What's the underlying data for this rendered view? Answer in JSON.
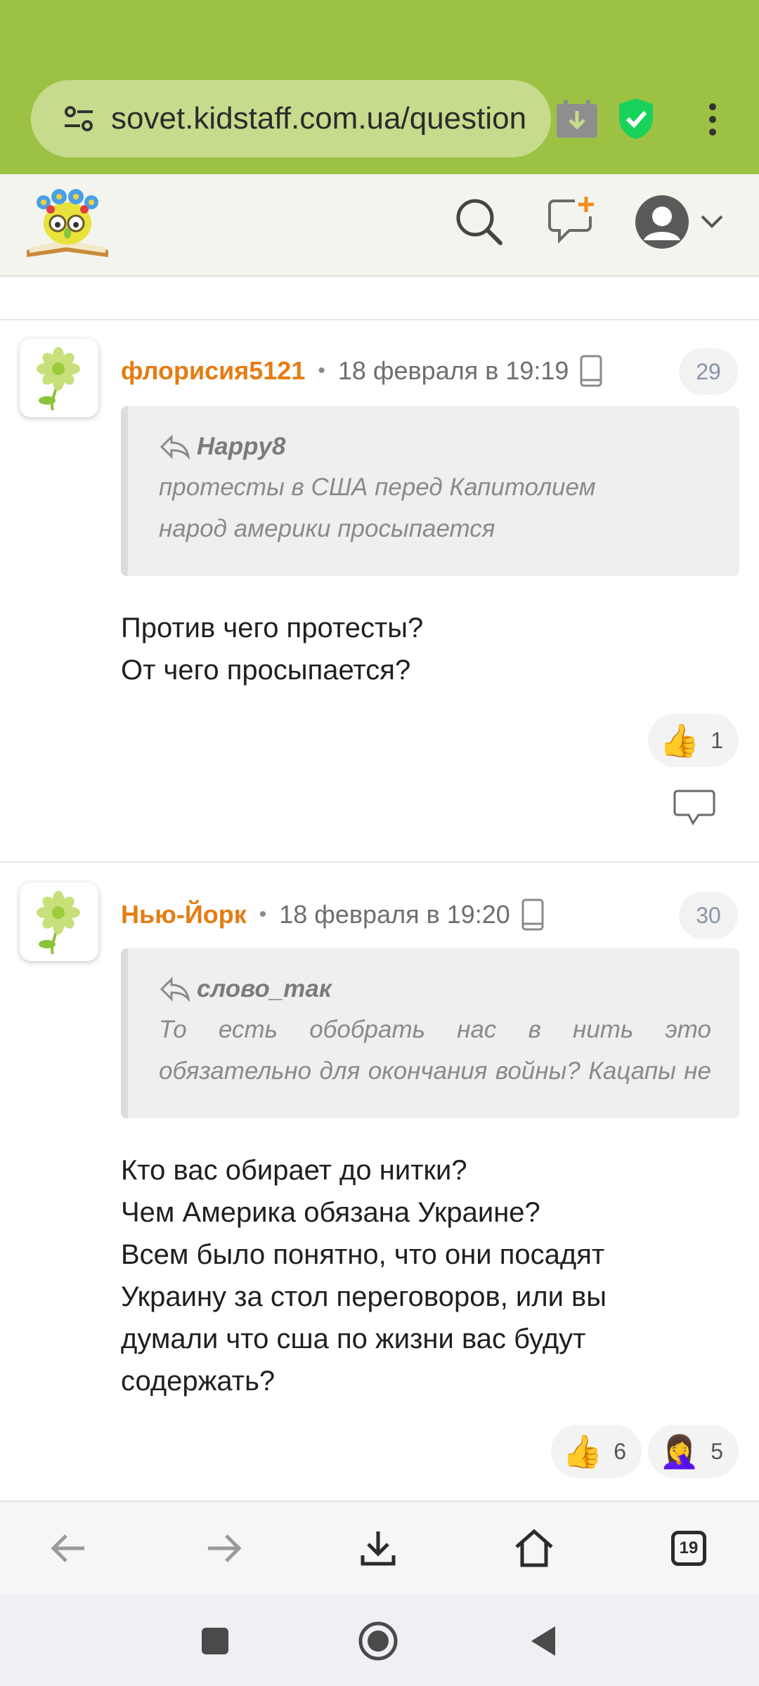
{
  "browser": {
    "url": "sovet.kidstaff.com.ua/question",
    "tab_count": "19"
  },
  "comments": [
    {
      "author": "флорисия5121",
      "date": "18 февраля в 19:19",
      "number": "29",
      "quote_author": "Happy8",
      "quote_lines": [
        "протесты в США перед Капитолием",
        "народ америки просыпается"
      ],
      "body_lines": [
        "Против чего протесты?",
        "От чего просыпается?"
      ],
      "reactions": [
        {
          "emoji": "👍",
          "count": "1"
        }
      ]
    },
    {
      "author": "Нью-Йорк",
      "date": "18 февраля в 19:20",
      "number": "30",
      "quote_author": "слово_так",
      "quote_text": "То есть обобрать нас в нить это обязательно для окончания войны? Кацапы не теря…",
      "body_lines": [
        "Кто вас обирает до нитки?",
        "Чем Америка обязана Украине?",
        "Всем было понятно, что они посадят",
        "Украину за стол переговоров, или вы",
        "думали что сша по жизни вас будут",
        "содержать?"
      ],
      "reactions": [
        {
          "emoji": "👍",
          "count": "6"
        },
        {
          "emoji": "🤦‍♀️",
          "count": "5"
        }
      ]
    }
  ]
}
